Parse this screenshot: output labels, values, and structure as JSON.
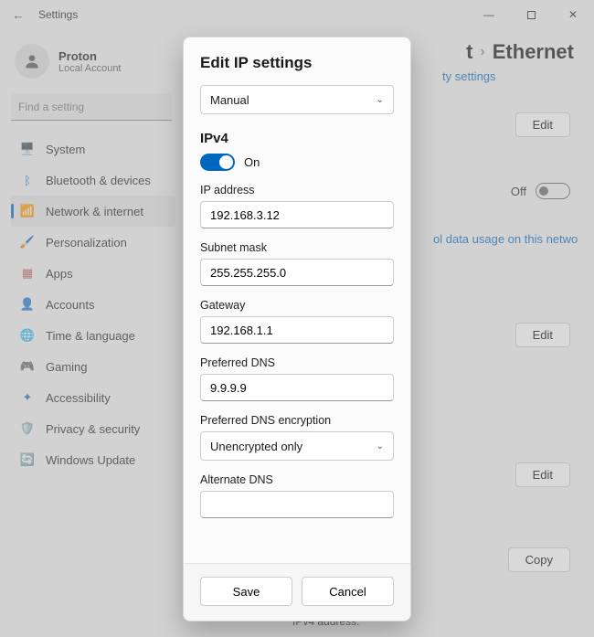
{
  "window": {
    "title": "Settings"
  },
  "account": {
    "name": "Proton",
    "sub": "Local Account"
  },
  "search": {
    "placeholder": "Find a setting"
  },
  "nav": {
    "items": [
      {
        "label": "System",
        "icon": "🖥️",
        "color": "#0067c0"
      },
      {
        "label": "Bluetooth & devices",
        "icon": "ᛒ",
        "color": "#0067c0"
      },
      {
        "label": "Network & internet",
        "icon": "📶",
        "color": "#0067c0",
        "selected": true
      },
      {
        "label": "Personalization",
        "icon": "🖌️",
        "color": "#5b5b5b"
      },
      {
        "label": "Apps",
        "icon": "▦",
        "color": "#c0504d"
      },
      {
        "label": "Accounts",
        "icon": "👤",
        "color": "#5b5b5b"
      },
      {
        "label": "Time & language",
        "icon": "🌐",
        "color": "#2a8a43"
      },
      {
        "label": "Gaming",
        "icon": "🎮",
        "color": "#5b5b5b"
      },
      {
        "label": "Accessibility",
        "icon": "✦",
        "color": "#1a6fa3"
      },
      {
        "label": "Privacy & security",
        "icon": "🛡️",
        "color": "#6b6b6b"
      },
      {
        "label": "Windows Update",
        "icon": "🔄",
        "color": "#0067c0"
      }
    ]
  },
  "breadcrumb": {
    "tail1": "t",
    "sep": "›",
    "tail2": "Ethernet"
  },
  "bg": {
    "link1": "ty settings",
    "edit": "Edit",
    "off": "Off",
    "datausage": "ol data usage on this netwo",
    "copy": "Copy",
    "ipv4label": "IPv4 address:"
  },
  "dialog": {
    "title": "Edit IP settings",
    "mode": "Manual",
    "section": "IPv4",
    "toggle_label": "On",
    "fields": {
      "ip_label": "IP address",
      "ip": "192.168.3.12",
      "mask_label": "Subnet mask",
      "mask": "255.255.255.0",
      "gw_label": "Gateway",
      "gw": "192.168.1.1",
      "pdns_label": "Preferred DNS",
      "pdns": "9.9.9.9",
      "penc_label": "Preferred DNS encryption",
      "penc": "Unencrypted only",
      "adns_label": "Alternate DNS"
    },
    "save": "Save",
    "cancel": "Cancel"
  }
}
